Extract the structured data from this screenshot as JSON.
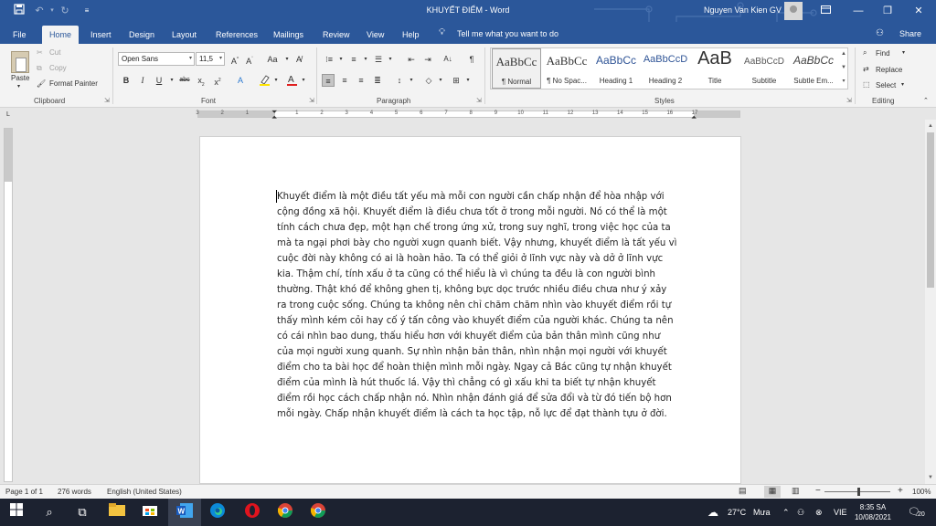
{
  "window": {
    "title": "KHUYẾT ĐIỂM - Word",
    "user_name": "Nguyen Van Kien GV"
  },
  "tabs": [
    "File",
    "Home",
    "Insert",
    "Design",
    "Layout",
    "References",
    "Mailings",
    "Review",
    "View",
    "Help"
  ],
  "tell_me": "Tell me what you want to do",
  "share_label": "Share",
  "clipboard": {
    "paste": "Paste",
    "cut": "Cut",
    "copy": "Copy",
    "format_painter": "Format Painter",
    "label": "Clipboard"
  },
  "font": {
    "name": "Open Sans",
    "size": "11,5",
    "change_case": "Aa",
    "label": "Font"
  },
  "paragraph": {
    "label": "Paragraph"
  },
  "styles": {
    "label": "Styles",
    "items": [
      {
        "sample": "AaBbCc",
        "name": "¶ Normal"
      },
      {
        "sample": "AaBbCc",
        "name": "¶ No Spac..."
      },
      {
        "sample": "AaBbCc",
        "name": "Heading 1"
      },
      {
        "sample": "AaBbCcD",
        "name": "Heading 2"
      },
      {
        "sample": "AaB",
        "name": "Title"
      },
      {
        "sample": "AaBbCcD",
        "name": "Subtitle"
      },
      {
        "sample": "AaBbCc",
        "name": "Subtle Em..."
      }
    ]
  },
  "editing": {
    "find": "Find",
    "replace": "Replace",
    "select": "Select",
    "label": "Editing"
  },
  "ruler_numbers": [
    "3",
    "2",
    "1",
    "1",
    "2",
    "3",
    "4",
    "5",
    "6",
    "7",
    "8",
    "9",
    "10",
    "11",
    "12",
    "13",
    "14",
    "15",
    "16",
    "17"
  ],
  "document": {
    "lines": [
      "Khuyết điểm là một điều tất yếu mà mỗi con người cần chấp nhận để hòa nhập với",
      "cộng đồng xã hội. Khuyết điểm là điều chưa tốt ở trong mỗi người. Nó có thể là một",
      "tính cách chưa đẹp, một hạn chế trong ứng xử, trong suy nghĩ, trong việc học của ta",
      "mà ta ngại phơi bày cho người xugn quanh biết. Vậy nhưng, khuyết điểm là tất yếu vì",
      "cuộc đời này không có ai là hoàn hảo. Ta có thể giỏi ở lĩnh vực này và dở ở lĩnh vực",
      "kia. Thậm chí, tính xấu ở ta cũng có thể hiểu là vì chúng ta đều là con người bình",
      "thường. Thật khó để không ghen tị, không bực dọc trước nhiều điều chưa như ý xảy",
      "ra trong cuộc sống. Chúng ta không nên chỉ chăm chăm nhìn vào khuyết điểm rồi tự",
      "thấy mình kém cỏi hay cố ý tấn công vào khuyết điểm của người khác. Chúng ta nên",
      "có cái nhìn bao dung, thấu hiểu hơn với khuyết điểm của bản thân mình cũng như",
      "của mọi người xung quanh. Sự nhìn nhận bản thân, nhìn nhận mọi người với khuyết",
      "điểm cho ta bài học để hoàn thiện mình mỗi ngày. Ngay cả Bác cũng tự nhận khuyết",
      "điểm của mình là hút thuốc lá. Vậy thì chẳng có gì xấu khi ta biết tự nhận khuyết",
      "điểm rồi học cách chấp nhận nó. Nhìn nhận đánh giá để sửa đổi và từ đó tiến bộ hơn",
      "mỗi ngày. Chấp nhận khuyết điểm là cách ta học tập, nỗ lực để đạt thành tựu ở đời."
    ]
  },
  "status": {
    "page": "Page 1 of 1",
    "words": "276 words",
    "language": "English (United States)",
    "zoom": "100%"
  },
  "taskbar": {
    "weather_temp": "27°C",
    "weather_desc": "Mưa",
    "input_lang": "VIE",
    "time": "8:35 SA",
    "date": "10/08/2021",
    "notification_count": "20"
  }
}
